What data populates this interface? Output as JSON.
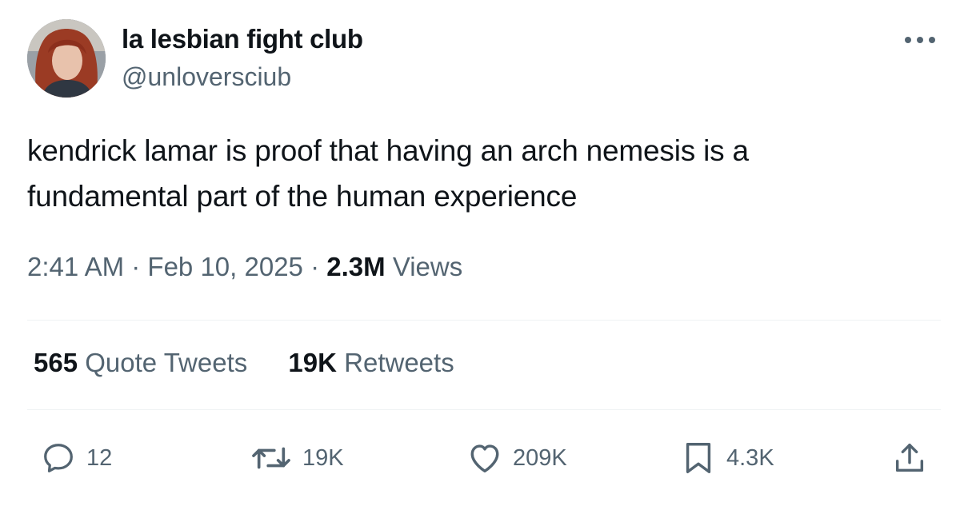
{
  "author": {
    "display_name": "la lesbian fight club",
    "handle": "@unloversciub"
  },
  "tweet": {
    "text": "kendrick lamar is proof that having an arch nemesis is a fundamental part of the human experience",
    "time": "2:41 AM",
    "date": "Feb 10, 2025",
    "separator": "·",
    "views_count": "2.3M",
    "views_label": "Views"
  },
  "stats": {
    "quote_count": "565",
    "quote_label": "Quote Tweets",
    "retweet_count": "19K",
    "retweet_label": "Retweets"
  },
  "actions": {
    "replies": "12",
    "retweets": "19K",
    "likes": "209K",
    "bookmarks": "4.3K"
  },
  "icons": {
    "more": "more-horizontal-icon",
    "reply": "speech-bubble-icon",
    "retweet": "retweet-arrows-icon",
    "like": "heart-icon",
    "bookmark": "bookmark-icon",
    "share": "share-arrow-icon"
  },
  "colors": {
    "text_primary": "#0f1419",
    "text_secondary": "#536471",
    "divider": "#eff3f4"
  }
}
